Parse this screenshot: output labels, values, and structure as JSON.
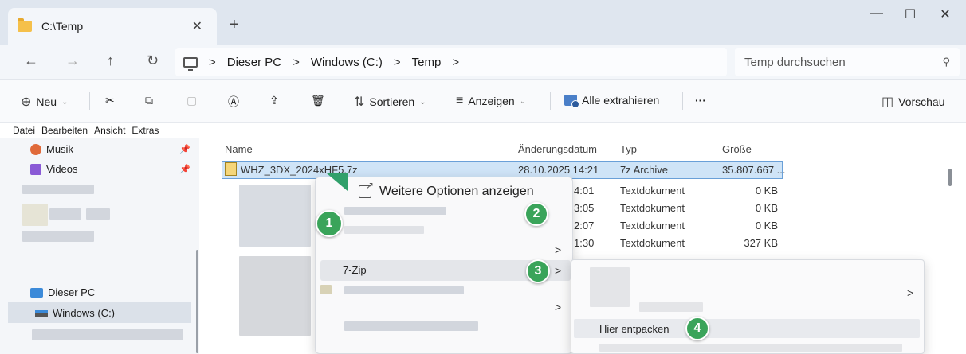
{
  "window": {
    "tab_title": "C:\\Temp",
    "tab_close": "✕",
    "new_tab": "+",
    "minimize": "—",
    "maximize": "☐",
    "close": "✕"
  },
  "nav": {
    "back": "←",
    "forward": "→",
    "up": "↑",
    "refresh": "↻",
    "breadcrumb": [
      "Dieser PC",
      "Windows (C:)",
      "Temp"
    ],
    "separator": ">",
    "search_placeholder": "Temp durchsuchen"
  },
  "commands": {
    "new": "Neu",
    "sort": "Sortieren",
    "view": "Anzeigen",
    "extract_all": "Alle extrahieren",
    "more": "···",
    "preview": "Vorschau"
  },
  "menubar": [
    "Datei",
    "Bearbeiten",
    "Ansicht",
    "Extras"
  ],
  "sidebar": {
    "music": "Musik",
    "videos": "Videos",
    "this_pc": "Dieser PC",
    "drive": "Windows (C:)"
  },
  "columns": {
    "name": "Name",
    "date": "Änderungsdatum",
    "type": "Typ",
    "size": "Größe"
  },
  "files": [
    {
      "name": "WHZ_3DX_2024xHF5.7z",
      "date": "28.10.2025 14:21",
      "type": "7z Archive",
      "size": "35.807.667 ..."
    },
    {
      "date": "4:01",
      "type": "Textdokument",
      "size": "0 KB"
    },
    {
      "date": "3:05",
      "type": "Textdokument",
      "size": "0 KB"
    },
    {
      "date": "2:07",
      "type": "Textdokument",
      "size": "0 KB"
    },
    {
      "date": "1:30",
      "type": "Textdokument",
      "size": "327 KB"
    }
  ],
  "context_menu": {
    "more_options": "Weitere Optionen anzeigen",
    "seven_zip": "7-Zip",
    "submenu_arrow": ">"
  },
  "submenu": {
    "extract_here": "Hier entpacken"
  },
  "steps": [
    "1",
    "2",
    "3",
    "4"
  ],
  "colors": {
    "accent_green": "#3aa45a",
    "selection": "#cfe4f7"
  }
}
